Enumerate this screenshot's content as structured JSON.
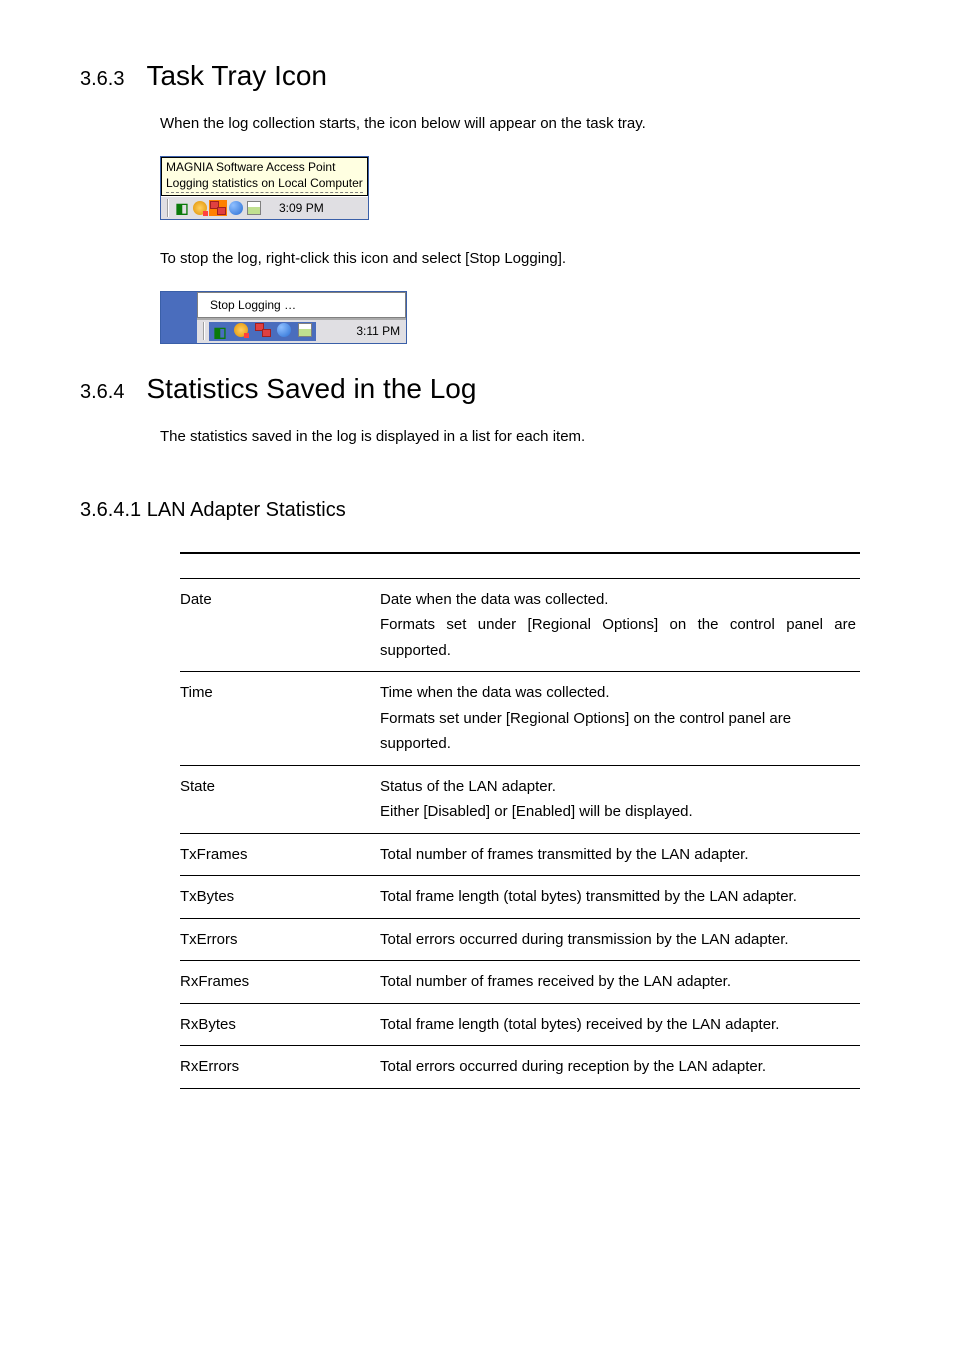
{
  "sections": {
    "s1": {
      "number": "3.6.3",
      "title": "Task Tray Icon",
      "para1": "When the log collection starts, the icon below will appear on the task tray.",
      "para2": "To stop the log, right-click this icon and select [Stop Logging]."
    },
    "s2": {
      "number": "3.6.4",
      "title": "Statistics Saved in the Log",
      "para1": "The statistics saved in the log is displayed in a list for each item."
    },
    "s3": {
      "title": "3.6.4.1 LAN Adapter Statistics"
    }
  },
  "tray_image1": {
    "tooltip_line1": "MAGNIA Software Access Point",
    "tooltip_line2": "Logging statistics on Local Computer",
    "time": "3:09 PM"
  },
  "tray_image2": {
    "menu_item": "Stop Logging …",
    "time": "3:11 PM"
  },
  "lan_table": {
    "rows": [
      {
        "name": "Date",
        "desc": "Date when the data was collected.\nFormats set under [Regional Options] on the control panel are supported.",
        "justify": true
      },
      {
        "name": "Time",
        "desc": "Time when the data was collected.\nFormats set under [Regional Options] on the control panel are supported."
      },
      {
        "name": "State",
        "desc": "Status of the LAN adapter.\nEither [Disabled] or [Enabled] will be displayed."
      },
      {
        "name": "TxFrames",
        "desc": "Total number of frames transmitted by the LAN adapter."
      },
      {
        "name": "TxBytes",
        "desc": "Total frame length (total bytes) transmitted by the LAN adapter."
      },
      {
        "name": "TxErrors",
        "desc": "Total errors occurred during transmission by the LAN adapter."
      },
      {
        "name": "RxFrames",
        "desc": "Total number of frames received by the LAN adapter."
      },
      {
        "name": "RxBytes",
        "desc": "Total frame length (total bytes) received by the LAN adapter."
      },
      {
        "name": "RxErrors",
        "desc": "Total errors occurred during reception by the LAN adapter."
      }
    ]
  }
}
